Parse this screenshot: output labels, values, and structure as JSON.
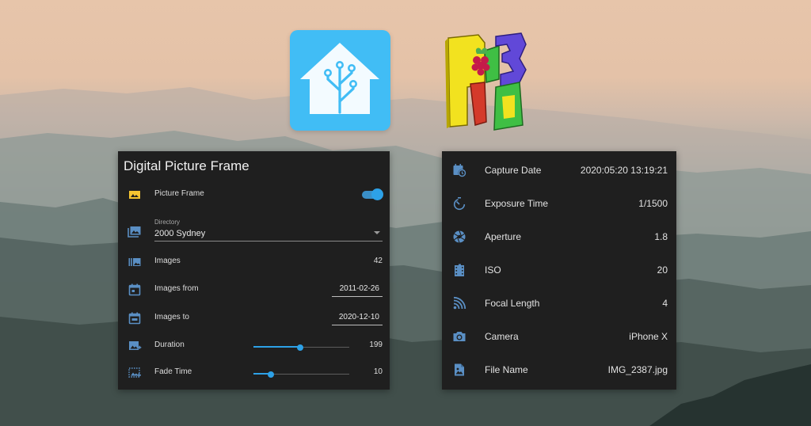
{
  "logos": {
    "home_assistant": "home-assistant-logo",
    "pi3d": "pi3d-logo",
    "pi3d_text": "Pi3D"
  },
  "colors": {
    "card_bg": "#1f1f1f",
    "accent": "#2da1e7",
    "icon_color": "#5a8fc4",
    "picture_icon": "#f4c430",
    "ha_blue": "#41bdf5"
  },
  "frame_card": {
    "title": "Digital Picture Frame",
    "picture_frame": {
      "label": "Picture Frame",
      "icon": "image-icon",
      "on": true
    },
    "directory": {
      "label": "Directory",
      "value": "2000 Sydney",
      "icon": "folder-image-icon"
    },
    "images": {
      "label": "Images",
      "value": "42",
      "icon": "image-multiple-icon"
    },
    "images_from": {
      "label": "Images from",
      "value": "2011-02-26",
      "icon": "calendar-icon"
    },
    "images_to": {
      "label": "Images to",
      "value": "2020-12-10",
      "icon": "calendar-icon"
    },
    "duration": {
      "label": "Duration",
      "value": "199",
      "icon": "image-plus-icon",
      "slider_fraction": 0.49
    },
    "fade_time": {
      "label": "Fade Time",
      "value": "10",
      "icon": "image-fade-icon",
      "slider_fraction": 0.18
    }
  },
  "exif_card": {
    "rows": [
      {
        "label": "Capture Date",
        "value": "2020:05:20 13:19:21",
        "icon": "calendar-clock-icon"
      },
      {
        "label": "Exposure Time",
        "value": "1/1500",
        "icon": "timer-icon"
      },
      {
        "label": "Aperture",
        "value": "1.8",
        "icon": "aperture-icon"
      },
      {
        "label": "ISO",
        "value": "20",
        "icon": "film-icon"
      },
      {
        "label": "Focal Length",
        "value": "4",
        "icon": "focal-length-icon"
      },
      {
        "label": "Camera",
        "value": "iPhone X",
        "icon": "camera-icon"
      },
      {
        "label": "File Name",
        "value": "IMG_2387.jpg",
        "icon": "file-image-icon"
      }
    ]
  }
}
